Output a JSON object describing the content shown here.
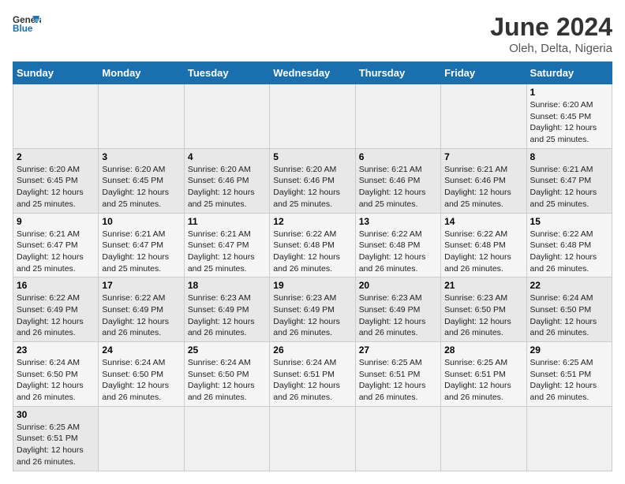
{
  "header": {
    "logo_text_regular": "General",
    "logo_text_blue": "Blue",
    "title": "June 2024",
    "subtitle": "Oleh, Delta, Nigeria"
  },
  "weekdays": [
    "Sunday",
    "Monday",
    "Tuesday",
    "Wednesday",
    "Thursday",
    "Friday",
    "Saturday"
  ],
  "weeks": [
    [
      {
        "day": "",
        "info": ""
      },
      {
        "day": "",
        "info": ""
      },
      {
        "day": "",
        "info": ""
      },
      {
        "day": "",
        "info": ""
      },
      {
        "day": "",
        "info": ""
      },
      {
        "day": "",
        "info": ""
      },
      {
        "day": "1",
        "info": "Sunrise: 6:20 AM\nSunset: 6:45 PM\nDaylight: 12 hours and 25 minutes."
      }
    ],
    [
      {
        "day": "2",
        "info": "Sunrise: 6:20 AM\nSunset: 6:45 PM\nDaylight: 12 hours and 25 minutes."
      },
      {
        "day": "3",
        "info": "Sunrise: 6:20 AM\nSunset: 6:45 PM\nDaylight: 12 hours and 25 minutes."
      },
      {
        "day": "4",
        "info": "Sunrise: 6:20 AM\nSunset: 6:46 PM\nDaylight: 12 hours and 25 minutes."
      },
      {
        "day": "5",
        "info": "Sunrise: 6:20 AM\nSunset: 6:46 PM\nDaylight: 12 hours and 25 minutes."
      },
      {
        "day": "6",
        "info": "Sunrise: 6:21 AM\nSunset: 6:46 PM\nDaylight: 12 hours and 25 minutes."
      },
      {
        "day": "7",
        "info": "Sunrise: 6:21 AM\nSunset: 6:46 PM\nDaylight: 12 hours and 25 minutes."
      },
      {
        "day": "8",
        "info": "Sunrise: 6:21 AM\nSunset: 6:47 PM\nDaylight: 12 hours and 25 minutes."
      }
    ],
    [
      {
        "day": "9",
        "info": "Sunrise: 6:21 AM\nSunset: 6:47 PM\nDaylight: 12 hours and 25 minutes."
      },
      {
        "day": "10",
        "info": "Sunrise: 6:21 AM\nSunset: 6:47 PM\nDaylight: 12 hours and 25 minutes."
      },
      {
        "day": "11",
        "info": "Sunrise: 6:21 AM\nSunset: 6:47 PM\nDaylight: 12 hours and 25 minutes."
      },
      {
        "day": "12",
        "info": "Sunrise: 6:22 AM\nSunset: 6:48 PM\nDaylight: 12 hours and 26 minutes."
      },
      {
        "day": "13",
        "info": "Sunrise: 6:22 AM\nSunset: 6:48 PM\nDaylight: 12 hours and 26 minutes."
      },
      {
        "day": "14",
        "info": "Sunrise: 6:22 AM\nSunset: 6:48 PM\nDaylight: 12 hours and 26 minutes."
      },
      {
        "day": "15",
        "info": "Sunrise: 6:22 AM\nSunset: 6:48 PM\nDaylight: 12 hours and 26 minutes."
      }
    ],
    [
      {
        "day": "16",
        "info": "Sunrise: 6:22 AM\nSunset: 6:49 PM\nDaylight: 12 hours and 26 minutes."
      },
      {
        "day": "17",
        "info": "Sunrise: 6:22 AM\nSunset: 6:49 PM\nDaylight: 12 hours and 26 minutes."
      },
      {
        "day": "18",
        "info": "Sunrise: 6:23 AM\nSunset: 6:49 PM\nDaylight: 12 hours and 26 minutes."
      },
      {
        "day": "19",
        "info": "Sunrise: 6:23 AM\nSunset: 6:49 PM\nDaylight: 12 hours and 26 minutes."
      },
      {
        "day": "20",
        "info": "Sunrise: 6:23 AM\nSunset: 6:49 PM\nDaylight: 12 hours and 26 minutes."
      },
      {
        "day": "21",
        "info": "Sunrise: 6:23 AM\nSunset: 6:50 PM\nDaylight: 12 hours and 26 minutes."
      },
      {
        "day": "22",
        "info": "Sunrise: 6:24 AM\nSunset: 6:50 PM\nDaylight: 12 hours and 26 minutes."
      }
    ],
    [
      {
        "day": "23",
        "info": "Sunrise: 6:24 AM\nSunset: 6:50 PM\nDaylight: 12 hours and 26 minutes."
      },
      {
        "day": "24",
        "info": "Sunrise: 6:24 AM\nSunset: 6:50 PM\nDaylight: 12 hours and 26 minutes."
      },
      {
        "day": "25",
        "info": "Sunrise: 6:24 AM\nSunset: 6:50 PM\nDaylight: 12 hours and 26 minutes."
      },
      {
        "day": "26",
        "info": "Sunrise: 6:24 AM\nSunset: 6:51 PM\nDaylight: 12 hours and 26 minutes."
      },
      {
        "day": "27",
        "info": "Sunrise: 6:25 AM\nSunset: 6:51 PM\nDaylight: 12 hours and 26 minutes."
      },
      {
        "day": "28",
        "info": "Sunrise: 6:25 AM\nSunset: 6:51 PM\nDaylight: 12 hours and 26 minutes."
      },
      {
        "day": "29",
        "info": "Sunrise: 6:25 AM\nSunset: 6:51 PM\nDaylight: 12 hours and 26 minutes."
      }
    ],
    [
      {
        "day": "30",
        "info": "Sunrise: 6:25 AM\nSunset: 6:51 PM\nDaylight: 12 hours and 26 minutes."
      },
      {
        "day": "",
        "info": ""
      },
      {
        "day": "",
        "info": ""
      },
      {
        "day": "",
        "info": ""
      },
      {
        "day": "",
        "info": ""
      },
      {
        "day": "",
        "info": ""
      },
      {
        "day": "",
        "info": ""
      }
    ]
  ]
}
